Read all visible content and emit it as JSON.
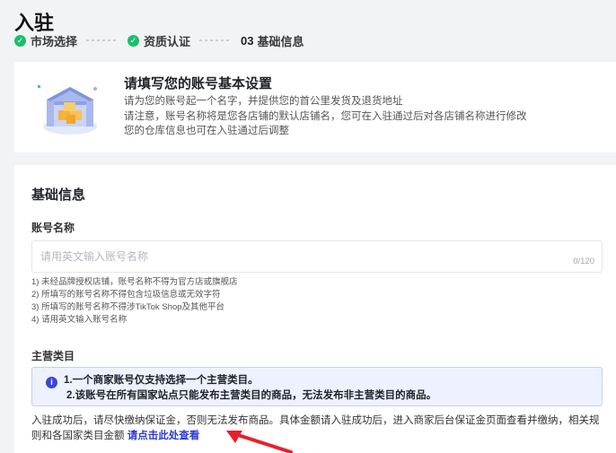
{
  "page": {
    "title": "入驻"
  },
  "steps": [
    {
      "label": "市场选择",
      "status": "done"
    },
    {
      "label": "资质认证",
      "status": "done"
    },
    {
      "number": "03",
      "label": "基础信息",
      "status": "current"
    }
  ],
  "intro": {
    "title": "请填写您的账号基本设置",
    "lines": [
      "请为您的账号起一个名字，并提供您的首公里发货及退货地址",
      "请注意，账号名称将是您各店铺的默认店铺名，您可在入驻通过后对各店铺名称进行修改",
      "您的仓库信息也可在入驻通过后调整"
    ]
  },
  "form": {
    "section_title": "基础信息",
    "account_name": {
      "label": "账号名称",
      "value": "",
      "placeholder": "请用英文输入账号名称",
      "counter": "0/120",
      "rules": [
        "1) 未经品牌授权店铺，账号名称不得为官方店或旗舰店",
        "2) 所填写的账号名称不得包含垃圾信息或无效字符",
        "3) 所填写的账号名称不得涉TikTok Shop及其他平台",
        "4) 请用英文输入账号名称"
      ]
    },
    "main_category": {
      "label": "主营类目",
      "notice": [
        "1.一个商家账号仅支持选择一个主营类目。",
        "2.该账号在所有国家站点只能发布主营类目的商品，无法发布非主营类目的商品。"
      ]
    },
    "deposit_note": {
      "text": "入驻成功后，请尽快缴纳保证金，否则无法发布商品。具体金额请入驻成功后，进入商家后台保证金页面查看并缴纳，相关规则和各国家类目金额",
      "link": "请点击此处查看"
    }
  },
  "colors": {
    "accent": "#2a3ad6",
    "success": "#1bbf6b",
    "notice_bg": "#eef1ff",
    "annotation_arrow": "#e8202a"
  },
  "icons": {
    "step_done": "check-circle-icon",
    "notice": "info-icon",
    "illustration": "warehouse-illustration"
  }
}
